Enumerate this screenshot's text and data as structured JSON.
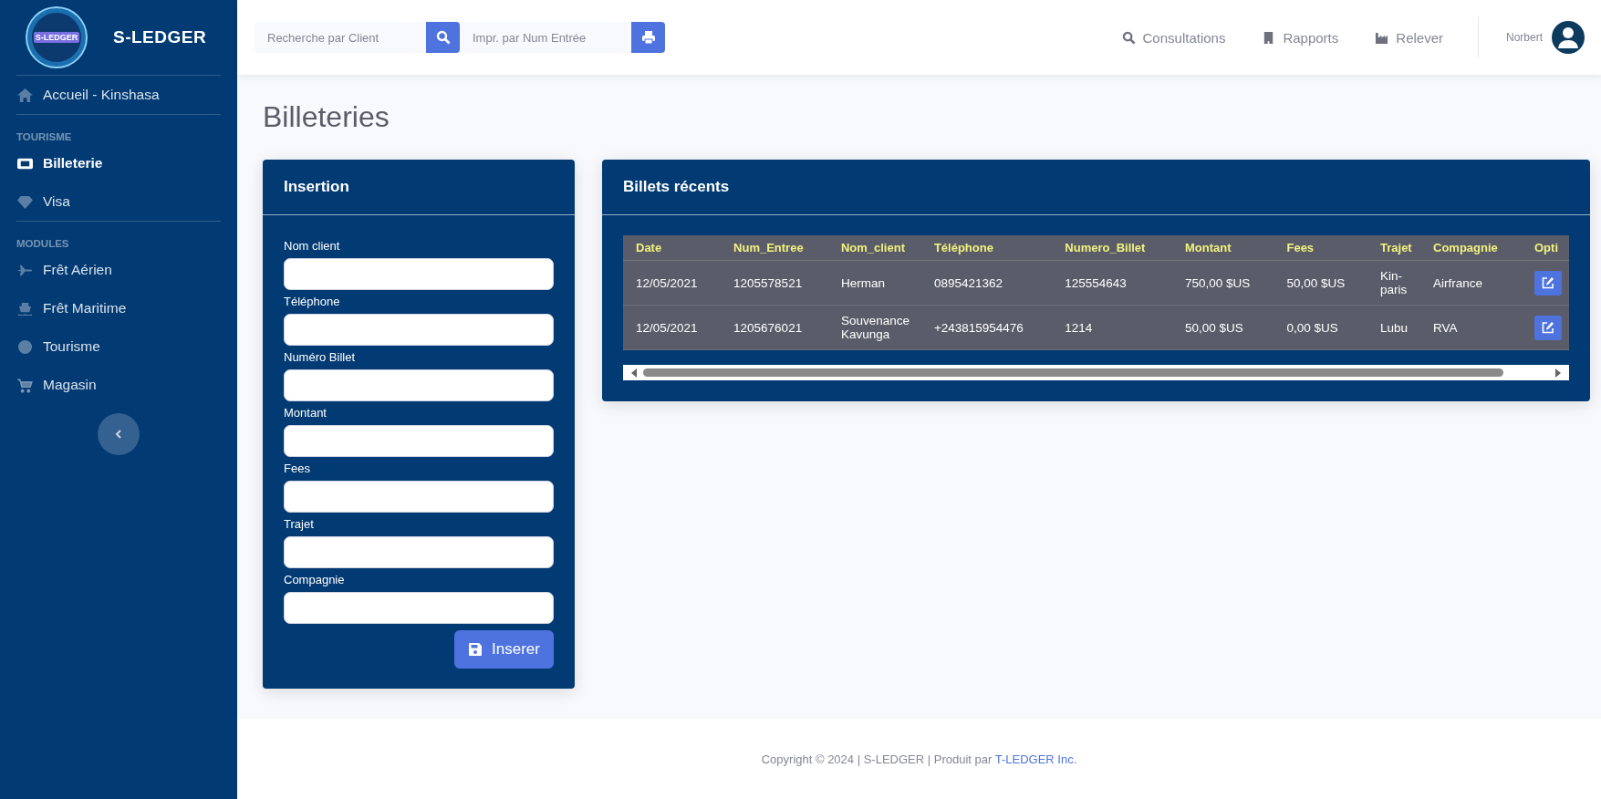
{
  "brand": {
    "name": "S-LEDGER",
    "logo_text": "S-LEDGER"
  },
  "search": {
    "placeholder": "Recherche par Client"
  },
  "print_search": {
    "placeholder": "Impr. par Num Entrée"
  },
  "top_nav": [
    {
      "label": "Consultations"
    },
    {
      "label": "Rapports"
    },
    {
      "label": "Relever"
    }
  ],
  "user": {
    "name": "Norbert"
  },
  "sidebar": {
    "home": {
      "label": "Accueil - Kinshasa",
      "selected": false
    },
    "sections": [
      {
        "heading": "TOURISME",
        "items": [
          {
            "label": "Billeterie",
            "selected": true
          },
          {
            "label": "Visa",
            "selected": false
          }
        ]
      },
      {
        "heading": "MODULES",
        "items": [
          {
            "label": "Frêt Aérien",
            "selected": false
          },
          {
            "label": "Frêt Maritime",
            "selected": false
          },
          {
            "label": "Tourisme",
            "selected": false
          },
          {
            "label": "Magasin",
            "selected": false
          }
        ]
      }
    ]
  },
  "page_title": "Billeteries",
  "form": {
    "title": "Insertion",
    "fields": [
      {
        "label": "Nom client"
      },
      {
        "label": "Téléphone"
      },
      {
        "label": "Numéro Billet"
      },
      {
        "label": "Montant"
      },
      {
        "label": "Fees"
      },
      {
        "label": "Trajet"
      },
      {
        "label": "Compagnie"
      }
    ],
    "submit": "Inserer"
  },
  "table": {
    "title": "Billets récents",
    "columns": [
      "Date",
      "Num_Entree",
      "Nom_client",
      "Téléphone",
      "Numero_Billet",
      "Montant",
      "Fees",
      "Trajet",
      "Compagnie",
      "Opti"
    ],
    "rows": [
      {
        "cells": [
          "12/05/2021",
          "1205578521",
          "Herman",
          "0895421362",
          "125554643",
          "750,00 $US",
          "50,00 $US",
          "Kin-paris",
          "Airfrance"
        ]
      },
      {
        "cells": [
          "12/05/2021",
          "1205676021",
          "Souvenance Kavunga",
          "+243815954476",
          "1214",
          "50,00 $US",
          "0,00 $US",
          "Lubu",
          "RVA"
        ]
      }
    ]
  },
  "footer": {
    "text": "Copyright © 2024 | S-LEDGER | Produit par ",
    "link": "T-LEDGER Inc."
  }
}
